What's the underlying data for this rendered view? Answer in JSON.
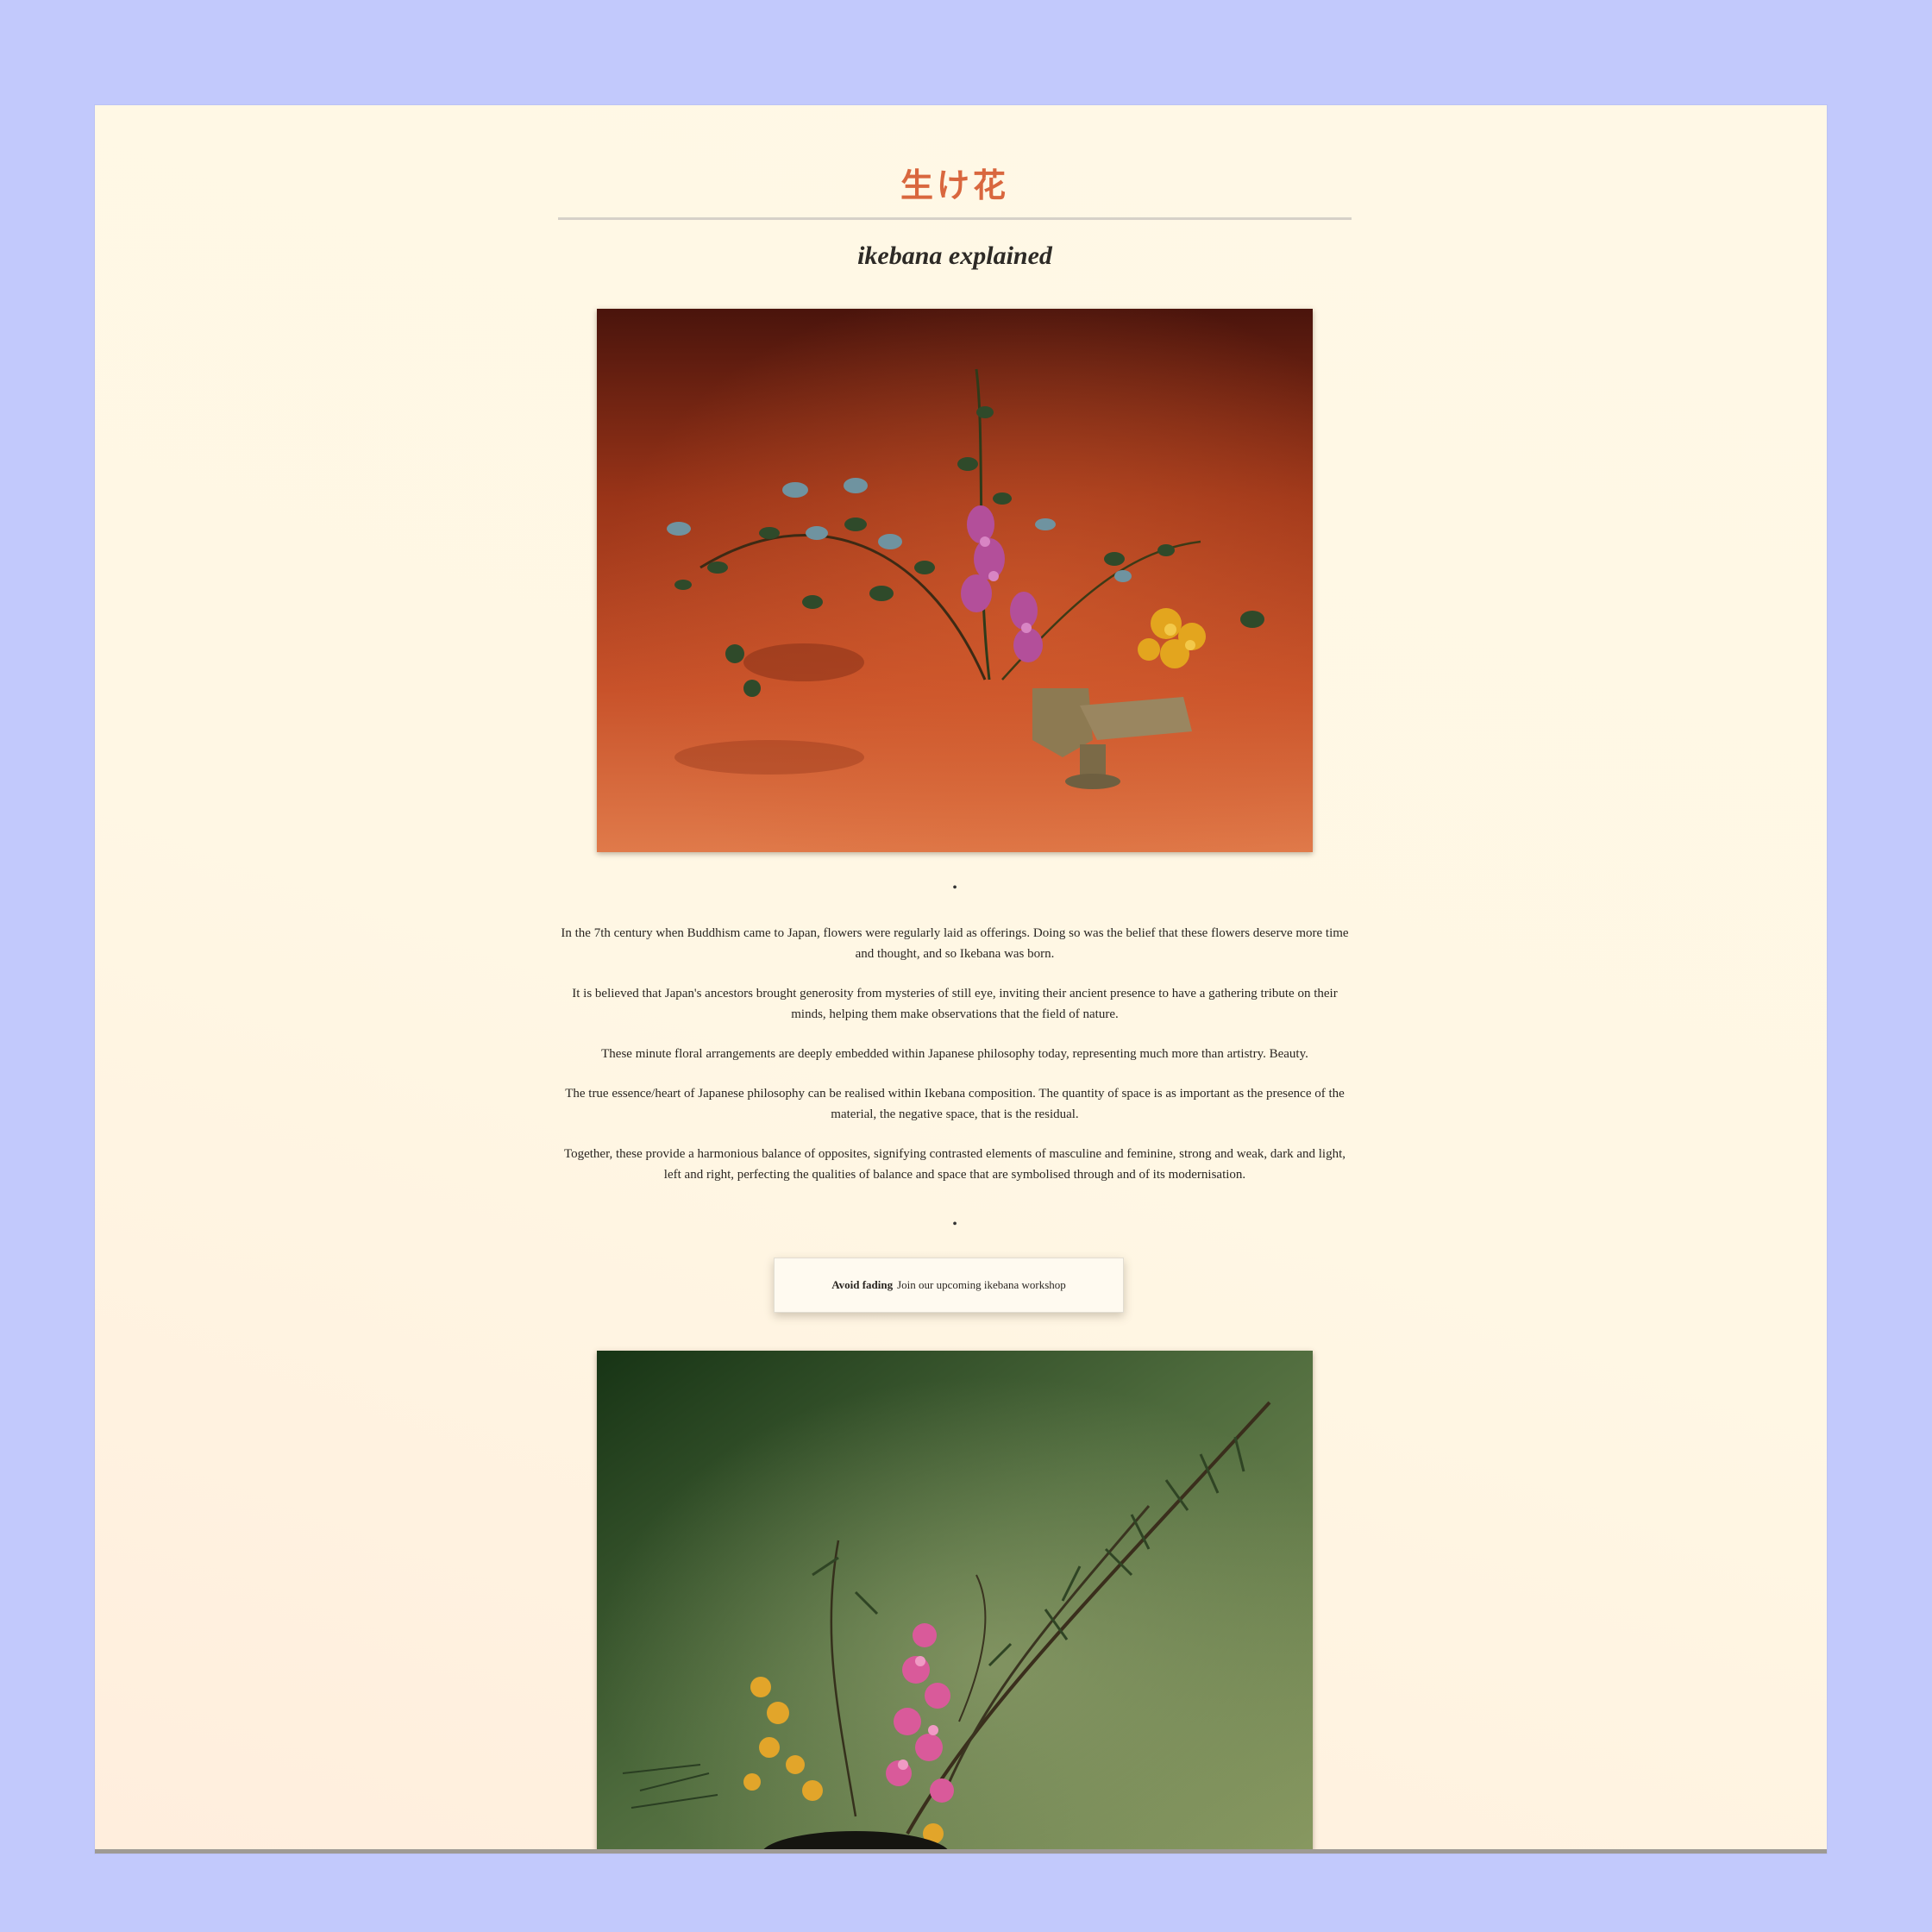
{
  "header": {
    "title": "生け花",
    "subtitle": "ikebana explained"
  },
  "article": {
    "dot": "•",
    "paragraphs": [
      "In the 7th century when Buddhism came to Japan, flowers were regularly laid as offerings. Doing so was the belief that these flowers deserve more time and thought, and so Ikebana was born.",
      "It is believed that Japan's ancestors brought generosity from mysteries of still eye, inviting their ancient presence to have a gathering tribute on their minds, helping them make observations that the field of nature.",
      "These minute floral arrangements are deeply embedded within Japanese philosophy today, representing much more than artistry. Beauty.",
      "The true essence/heart of Japanese philosophy can be realised within Ikebana composition. The quantity of space is as important as the presence of the material, the negative space, that is the residual.",
      "Together, these provide a harmonious balance of opposites, signifying contrasted elements of masculine and feminine, strong and weak, dark and light, left and right, perfecting the qualities of balance and space that are symbolised through and of its modernisation."
    ]
  },
  "cta": {
    "bold": "Avoid fading",
    "text": "Join our upcoming ikebana workshop"
  },
  "colors": {
    "background": "#c2c9fc",
    "page": "#fff7e4",
    "title": "#d9673e"
  },
  "images": [
    {
      "name": "ikebana-photo-red",
      "description_icon": "floral-arrangement-icon"
    },
    {
      "name": "ikebana-photo-green",
      "description_icon": "floral-arrangement-icon"
    }
  ]
}
